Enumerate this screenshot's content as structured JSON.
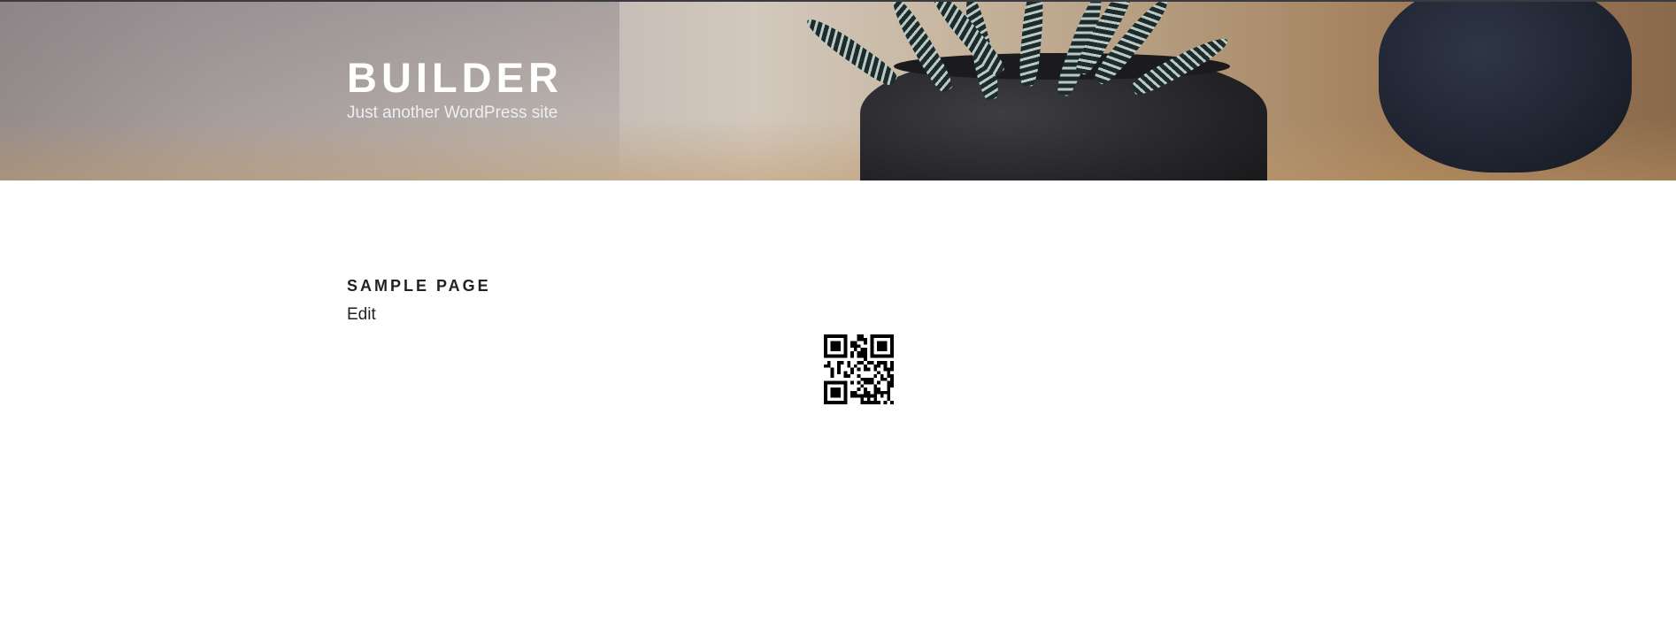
{
  "site": {
    "title": "BUILDER",
    "tagline": "Just another WordPress site"
  },
  "page": {
    "title": "SAMPLE PAGE",
    "edit_label": "Edit"
  },
  "icons": {
    "qr": "qr-code-image"
  }
}
